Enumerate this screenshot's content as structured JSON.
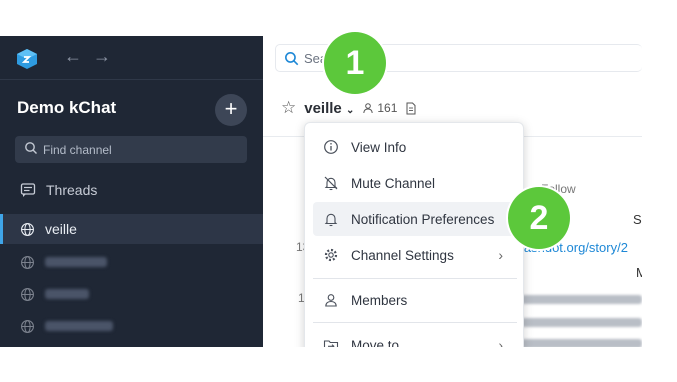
{
  "sidebar": {
    "team_name": "Demo kChat",
    "find_placeholder": "Find channel",
    "threads_label": "Threads",
    "channels": [
      {
        "label": "veille",
        "active": true
      },
      {
        "label": "abcacda",
        "blurred": true
      },
      {
        "label": "wxmtr",
        "blurred": true
      },
      {
        "label": "lukkvnrdmx",
        "blurred": true
      }
    ]
  },
  "main": {
    "search_placeholder": "Search",
    "channel_name": "veille",
    "member_count": "161",
    "background": {
      "follow": "Follow",
      "time1": "13",
      "time2": "1",
      "link": "lashdot.org/story/2",
      "letter_s": "S",
      "letter_m": "M"
    }
  },
  "menu": {
    "items": [
      {
        "label": "View Info",
        "icon": "info-icon"
      },
      {
        "label": "Mute Channel",
        "icon": "bell-off-icon"
      },
      {
        "label": "Notification Preferences",
        "icon": "bell-icon"
      },
      {
        "label": "Channel Settings",
        "icon": "gear-icon",
        "submenu": true
      },
      {
        "label": "Members",
        "icon": "user-icon"
      },
      {
        "label": "Move to...",
        "icon": "move-icon",
        "submenu": true
      }
    ]
  },
  "badges": {
    "step1": "1",
    "step2": "2"
  },
  "colors": {
    "sidebar_bg": "#1f2735",
    "accent": "#3fa5e8",
    "badge": "#5cc83b",
    "link": "#1e88d6"
  }
}
